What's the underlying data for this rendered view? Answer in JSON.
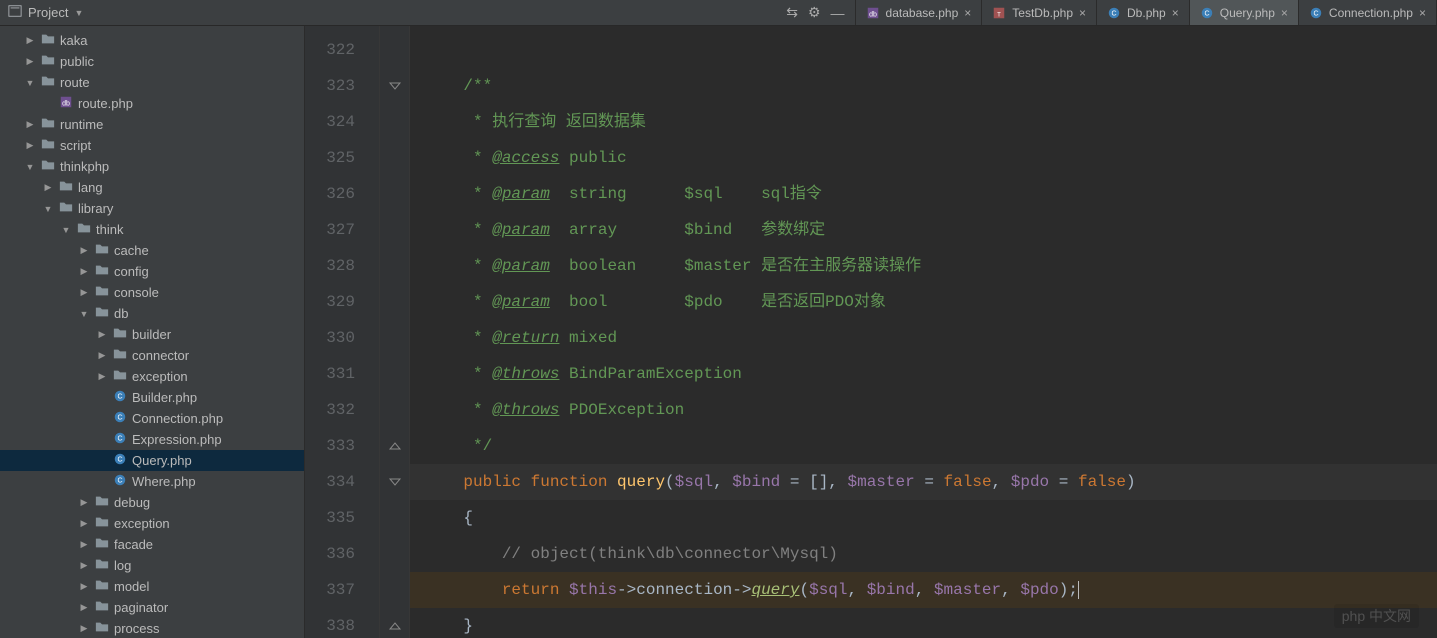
{
  "project_panel": {
    "title": "Project"
  },
  "tabs": [
    {
      "label": "database.php",
      "icon": "php-db",
      "active": false
    },
    {
      "label": "TestDb.php",
      "icon": "php-test",
      "active": false
    },
    {
      "label": "Db.php",
      "icon": "php-class",
      "active": false
    },
    {
      "label": "Query.php",
      "icon": "php-class",
      "active": true
    },
    {
      "label": "Connection.php",
      "icon": "php-class",
      "active": false
    }
  ],
  "tree": [
    {
      "indent": 1,
      "arrow": "right",
      "icon": "folder",
      "label": "kaka"
    },
    {
      "indent": 1,
      "arrow": "right",
      "icon": "folder",
      "label": "public"
    },
    {
      "indent": 1,
      "arrow": "down",
      "icon": "folder",
      "label": "route"
    },
    {
      "indent": 2,
      "arrow": "none",
      "icon": "php-db",
      "label": "route.php"
    },
    {
      "indent": 1,
      "arrow": "right",
      "icon": "folder",
      "label": "runtime"
    },
    {
      "indent": 1,
      "arrow": "right",
      "icon": "folder",
      "label": "script"
    },
    {
      "indent": 1,
      "arrow": "down",
      "icon": "folder",
      "label": "thinkphp"
    },
    {
      "indent": 2,
      "arrow": "right",
      "icon": "folder",
      "label": "lang"
    },
    {
      "indent": 2,
      "arrow": "down",
      "icon": "folder",
      "label": "library"
    },
    {
      "indent": 3,
      "arrow": "down",
      "icon": "folder",
      "label": "think"
    },
    {
      "indent": 4,
      "arrow": "right",
      "icon": "folder",
      "label": "cache"
    },
    {
      "indent": 4,
      "arrow": "right",
      "icon": "folder",
      "label": "config"
    },
    {
      "indent": 4,
      "arrow": "right",
      "icon": "folder",
      "label": "console"
    },
    {
      "indent": 4,
      "arrow": "down",
      "icon": "folder",
      "label": "db"
    },
    {
      "indent": 5,
      "arrow": "right",
      "icon": "folder",
      "label": "builder"
    },
    {
      "indent": 5,
      "arrow": "right",
      "icon": "folder",
      "label": "connector"
    },
    {
      "indent": 5,
      "arrow": "right",
      "icon": "folder",
      "label": "exception"
    },
    {
      "indent": 5,
      "arrow": "none",
      "icon": "php-class",
      "label": "Builder.php"
    },
    {
      "indent": 5,
      "arrow": "none",
      "icon": "php-class",
      "label": "Connection.php"
    },
    {
      "indent": 5,
      "arrow": "none",
      "icon": "php-class",
      "label": "Expression.php"
    },
    {
      "indent": 5,
      "arrow": "none",
      "icon": "php-class",
      "label": "Query.php",
      "selected": true
    },
    {
      "indent": 5,
      "arrow": "none",
      "icon": "php-class",
      "label": "Where.php"
    },
    {
      "indent": 4,
      "arrow": "right",
      "icon": "folder",
      "label": "debug"
    },
    {
      "indent": 4,
      "arrow": "right",
      "icon": "folder",
      "label": "exception"
    },
    {
      "indent": 4,
      "arrow": "right",
      "icon": "folder",
      "label": "facade"
    },
    {
      "indent": 4,
      "arrow": "right",
      "icon": "folder",
      "label": "log"
    },
    {
      "indent": 4,
      "arrow": "right",
      "icon": "folder",
      "label": "model"
    },
    {
      "indent": 4,
      "arrow": "right",
      "icon": "folder",
      "label": "paginator"
    },
    {
      "indent": 4,
      "arrow": "right",
      "icon": "folder",
      "label": "process"
    }
  ],
  "editor": {
    "first_line": 322,
    "lines": [
      {
        "n": 322,
        "segs": []
      },
      {
        "n": 323,
        "mark": "fold-down",
        "segs": [
          [
            "    ",
            "p"
          ],
          [
            "/**",
            "doc"
          ]
        ]
      },
      {
        "n": 324,
        "segs": [
          [
            "     * 执行查询 返回数据集",
            "doc"
          ]
        ]
      },
      {
        "n": 325,
        "segs": [
          [
            "     * ",
            "doc"
          ],
          [
            "@access",
            "doctag"
          ],
          [
            " public",
            "doc"
          ]
        ]
      },
      {
        "n": 326,
        "segs": [
          [
            "     * ",
            "doc"
          ],
          [
            "@param",
            "doctag"
          ],
          [
            "  string      $sql    sql指令",
            "doc"
          ]
        ]
      },
      {
        "n": 327,
        "segs": [
          [
            "     * ",
            "doc"
          ],
          [
            "@param",
            "doctag"
          ],
          [
            "  array       $bind   参数绑定",
            "doc"
          ]
        ]
      },
      {
        "n": 328,
        "segs": [
          [
            "     * ",
            "doc"
          ],
          [
            "@param",
            "doctag"
          ],
          [
            "  boolean     $master 是否在主服务器读操作",
            "doc"
          ]
        ]
      },
      {
        "n": 329,
        "segs": [
          [
            "     * ",
            "doc"
          ],
          [
            "@param",
            "doctag"
          ],
          [
            "  bool        $pdo    是否返回PDO对象",
            "doc"
          ]
        ]
      },
      {
        "n": 330,
        "segs": [
          [
            "     * ",
            "doc"
          ],
          [
            "@return",
            "doctag"
          ],
          [
            " mixed",
            "doc"
          ]
        ]
      },
      {
        "n": 331,
        "segs": [
          [
            "     * ",
            "doc"
          ],
          [
            "@throws",
            "doctag"
          ],
          [
            " BindParamException",
            "doc"
          ]
        ]
      },
      {
        "n": 332,
        "segs": [
          [
            "     * ",
            "doc"
          ],
          [
            "@throws",
            "doctag"
          ],
          [
            " PDOException",
            "doc"
          ]
        ]
      },
      {
        "n": 333,
        "mark": "fold-up",
        "segs": [
          [
            "     */",
            "doc"
          ]
        ]
      },
      {
        "n": 334,
        "mark": "fold-down",
        "hl": true,
        "segs": [
          [
            "    ",
            "p"
          ],
          [
            "public function ",
            "kw"
          ],
          [
            "query",
            "fn"
          ],
          [
            "(",
            "p"
          ],
          [
            "$sql",
            "var"
          ],
          [
            ", ",
            "p"
          ],
          [
            "$bind",
            "var"
          ],
          [
            " = [], ",
            "p"
          ],
          [
            "$master",
            "var"
          ],
          [
            " = ",
            "p"
          ],
          [
            "false",
            "kw"
          ],
          [
            ", ",
            "p"
          ],
          [
            "$pdo",
            "var"
          ],
          [
            " = ",
            "p"
          ],
          [
            "false",
            "kw"
          ],
          [
            ")",
            "p"
          ]
        ]
      },
      {
        "n": 335,
        "segs": [
          [
            "    {",
            "p"
          ]
        ]
      },
      {
        "n": 336,
        "segs": [
          [
            "        ",
            "p"
          ],
          [
            "// object(think\\db\\connector\\Mysql)",
            "comment"
          ]
        ]
      },
      {
        "n": 337,
        "cur": true,
        "segs": [
          [
            "        ",
            "p"
          ],
          [
            "return ",
            "kw"
          ],
          [
            "$this",
            "var"
          ],
          [
            "->",
            "p"
          ],
          [
            "connection",
            "p"
          ],
          [
            "->",
            "p"
          ],
          [
            "query",
            "link"
          ],
          [
            "(",
            "p"
          ],
          [
            "$sql",
            "var"
          ],
          [
            ", ",
            "p"
          ],
          [
            "$bind",
            "var"
          ],
          [
            ", ",
            "p"
          ],
          [
            "$master",
            "var"
          ],
          [
            ", ",
            "p"
          ],
          [
            "$pdo",
            "var"
          ],
          [
            ");",
            "p"
          ]
        ]
      },
      {
        "n": 338,
        "mark": "fold-up",
        "segs": [
          [
            "    }",
            "p"
          ]
        ]
      }
    ]
  },
  "watermark": "php 中文网"
}
